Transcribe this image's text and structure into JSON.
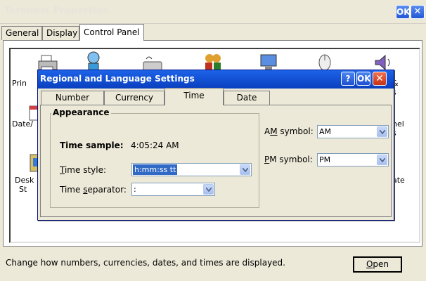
{
  "window": {
    "title": "Terminal Properties",
    "ok_label": "OK",
    "close_label": "✕"
  },
  "outer_tabs": [
    {
      "label": "General"
    },
    {
      "label": "Display"
    },
    {
      "label": "Control Panel"
    }
  ],
  "control_panel": {
    "items_left": [
      {
        "label": "Prin"
      },
      {
        "label": "Date/"
      },
      {
        "label": "Desk"
      },
      {
        "label": "St"
      }
    ],
    "items_right": [
      {
        "label": "&"
      },
      {
        "label": "s"
      },
      {
        "label": "nel"
      },
      {
        "label": "s"
      },
      {
        "label": "ate"
      }
    ]
  },
  "status_text": "Change how numbers, currencies, dates, and times are displayed.",
  "open_button": {
    "prefix": "",
    "underline": "O",
    "rest": "pen"
  },
  "dialog": {
    "title": "Regional and Language Settings",
    "help_label": "?",
    "ok_label": "OK",
    "close_label": "✕",
    "tabs": [
      {
        "label": "Number"
      },
      {
        "label": "Currency"
      },
      {
        "label": "Time"
      },
      {
        "label": "Date"
      }
    ],
    "active_tab": "Time",
    "appearance": {
      "group_title": "Appearance",
      "time_sample_label": "Time sample:",
      "time_sample_value": "4:05:24 AM",
      "time_style_label_u": "T",
      "time_style_label_rest": "ime style:",
      "time_style_value": "h:mm:ss tt",
      "time_separator_label_a": "Time ",
      "time_separator_label_u": "s",
      "time_separator_label_b": "eparator:",
      "time_separator_value": ":"
    },
    "am_symbol_label_a": "A",
    "am_symbol_label_u": "M",
    "am_symbol_label_b": " symbol:",
    "am_symbol_value": "AM",
    "pm_symbol_label_u": "P",
    "pm_symbol_label_b": "M symbol:",
    "pm_symbol_value": "PM"
  }
}
